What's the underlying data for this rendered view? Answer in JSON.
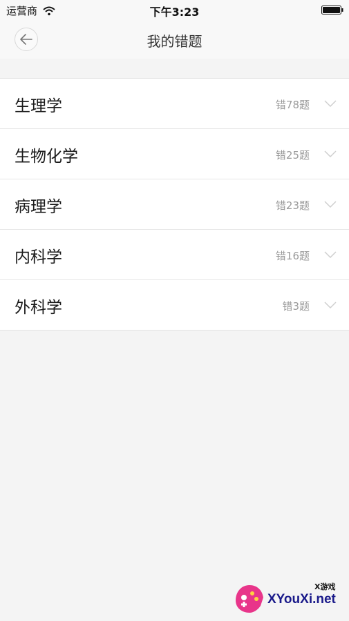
{
  "status_bar": {
    "carrier": "运营商",
    "time": "下午3:23"
  },
  "nav": {
    "title": "我的错题"
  },
  "subjects": [
    {
      "name": "生理学",
      "count": "错78题"
    },
    {
      "name": "生物化学",
      "count": "错25题"
    },
    {
      "name": "病理学",
      "count": "错23题"
    },
    {
      "name": "内科学",
      "count": "错16题"
    },
    {
      "name": "外科学",
      "count": "错3题"
    }
  ],
  "watermark": {
    "site": "XYouXi.net",
    "tag": "X游戏"
  },
  "icons": {
    "back": "arrow-left-icon",
    "expand": "chevron-down-icon",
    "wifi": "wifi-icon",
    "battery": "battery-icon"
  }
}
